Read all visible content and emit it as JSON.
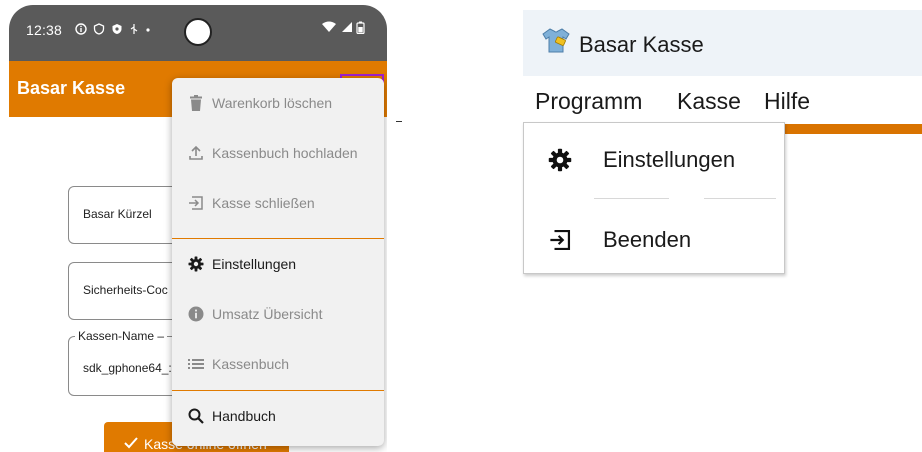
{
  "phone": {
    "status": {
      "time": "12:38",
      "left_icons": [
        "info-circle-icon",
        "shield-off-icon",
        "shield-icon",
        "usb-icon",
        "dot-icon"
      ],
      "right_icons": [
        "wifi-icon",
        "signal-icon",
        "battery-icon"
      ]
    },
    "appbar": {
      "title": "Basar Kasse",
      "menu_icon": "hamburger-icon"
    },
    "form": {
      "kuerzel_label": "Basar Kürzel",
      "sicherheitscode_label": "Sicherheits-Coc",
      "kassenname_legend": "Kassen-Name –",
      "kassenname_value": "sdk_gphone64_:"
    },
    "bottom_button": {
      "label": "Kasse online öffnen"
    },
    "menu": {
      "items": [
        {
          "label": "Warenkorb löschen",
          "icon": "trash-icon",
          "enabled": false
        },
        {
          "label": "Kassenbuch hochladen",
          "icon": "upload-icon",
          "enabled": false
        },
        {
          "label": "Kasse schließen",
          "icon": "logout-icon",
          "enabled": false
        },
        {
          "label": "Einstellungen",
          "icon": "gear-icon",
          "enabled": true
        },
        {
          "label": "Umsatz Übersicht",
          "icon": "info-icon",
          "enabled": false
        },
        {
          "label": "Kassenbuch",
          "icon": "list-icon",
          "enabled": false
        },
        {
          "label": "Handbuch",
          "icon": "search-icon",
          "enabled": true
        }
      ]
    }
  },
  "desktop": {
    "window_title": "Basar Kasse",
    "menubar": [
      "Programm",
      "Kasse",
      "Hilfe"
    ],
    "dropdown": [
      {
        "label": "Einstellungen",
        "icon": "gear-icon"
      },
      {
        "label": "Beenden",
        "icon": "exit-icon"
      }
    ]
  },
  "colors": {
    "accent_orange": "#e07a00",
    "highlight_purple": "#a020d0",
    "status_bar": "#5a5a5a",
    "titlebar": "#eef3f8"
  }
}
